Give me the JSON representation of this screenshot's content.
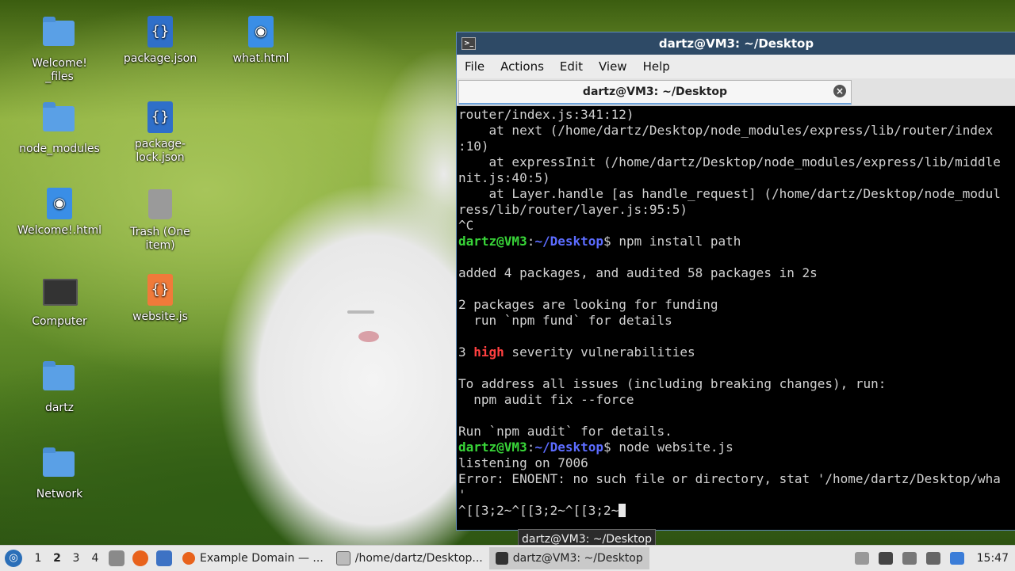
{
  "desktop": {
    "icons": [
      {
        "label": "Welcome!\n_files",
        "icon": "folder-icon"
      },
      {
        "label": "package.json",
        "icon": "json-file-icon"
      },
      {
        "label": "what.html",
        "icon": "html-file-icon"
      },
      {
        "label": "node_modules",
        "icon": "folder-icon"
      },
      {
        "label": "package-\nlock.json",
        "icon": "json-file-icon"
      },
      {
        "label": "Welcome!.html",
        "icon": "html-file-icon"
      },
      {
        "label": "Trash (One item)",
        "icon": "trash-icon"
      },
      {
        "label": "Computer",
        "icon": "computer-icon"
      },
      {
        "label": "website.js",
        "icon": "js-file-icon"
      },
      {
        "label": "dartz",
        "icon": "home-folder-icon"
      },
      {
        "label": "Network",
        "icon": "network-icon"
      }
    ]
  },
  "terminal": {
    "title": "dartz@VM3: ~/Desktop",
    "menu": [
      "File",
      "Actions",
      "Edit",
      "View",
      "Help"
    ],
    "tab_label": "dartz@VM3: ~/Desktop",
    "lines": {
      "l1": "router/index.js:341:12)",
      "l2": "    at next (/home/dartz/Desktop/node_modules/express/lib/router/index",
      "l3": ":10)",
      "l4": "    at expressInit (/home/dartz/Desktop/node_modules/express/lib/middle",
      "l5": "nit.js:40:5)",
      "l6": "    at Layer.handle [as handle_request] (/home/dartz/Desktop/node_modul",
      "l7": "ress/lib/router/layer.js:95:5)",
      "l8": "^C",
      "prompt_user": "dartz@VM3",
      "prompt_path": "~/Desktop",
      "cmd1": "$ npm install path",
      "l10": "added 4 packages, and audited 58 packages in 2s",
      "l12": "2 packages are looking for funding",
      "l13": "  run `npm fund` for details",
      "l15_pre": "3 ",
      "l15_high": "high",
      "l15_post": " severity vulnerabilities",
      "l17": "To address all issues (including breaking changes), run:",
      "l18": "  npm audit fix --force",
      "l20": "Run `npm audit` for details.",
      "cmd2": "$ node website.js",
      "l22": "listening on 7006",
      "l23": "Error: ENOENT: no such file or directory, stat '/home/dartz/Desktop/wha",
      "l24": "'",
      "l25": "^[[3;2~^[[3;2~^[[3;2~"
    }
  },
  "tooltip": "dartz@VM3: ~/Desktop",
  "taskbar": {
    "workspaces": [
      "1",
      "2",
      "3",
      "4"
    ],
    "tasks": [
      {
        "label": "Example Domain — ..."
      },
      {
        "label": "/home/dartz/Desktop..."
      },
      {
        "label": "dartz@VM3: ~/Desktop"
      }
    ],
    "clock": "15:47"
  }
}
